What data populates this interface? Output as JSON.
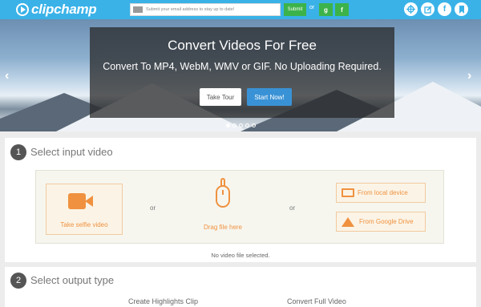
{
  "header": {
    "logo_text": "clipchamp",
    "email_placeholder": "Submit your email address to stay up to date!",
    "submit_label": "Submit",
    "or_label": "or",
    "google_label": "g",
    "facebook_label": "f",
    "accent_color": "#3ab2e8",
    "social_icons": [
      "crosshair-icon",
      "edit-icon",
      "facebook-icon",
      "bookmark-icon"
    ]
  },
  "hero": {
    "title": "Convert Videos For Free",
    "subtitle": "Convert To MP4, WebM, WMV or GIF. No Uploading Required.",
    "tour_label": "Take Tour",
    "start_label": "Start Now!",
    "slide_count": 5,
    "active_slide": 0
  },
  "step1": {
    "number": "1",
    "title": "Select input video",
    "selfie_label": "Take selfie video",
    "or1": "or",
    "drag_label": "Drag file here",
    "or2": "or",
    "local_label": "From local device",
    "drive_label": "From Google Drive",
    "status": "No video file selected."
  },
  "step2": {
    "number": "2",
    "title": "Select output type",
    "option1": "Create Highlights Clip",
    "option2": "Convert Full Video"
  }
}
